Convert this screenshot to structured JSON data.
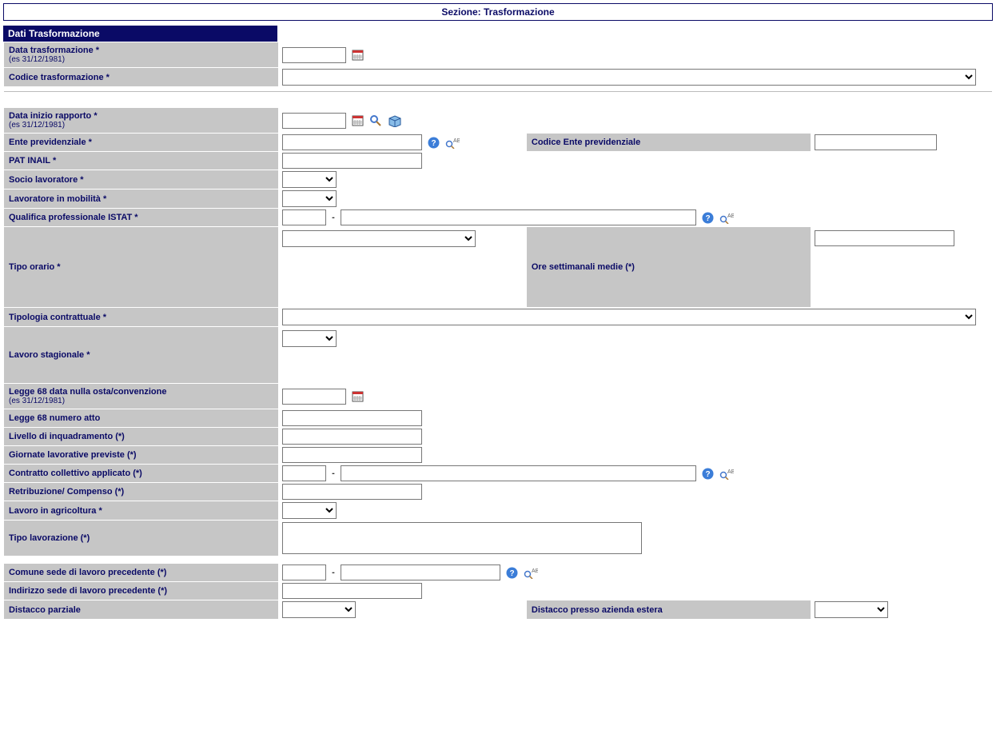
{
  "section_title": "Sezione: Trasformazione",
  "header": "Dati Trasformazione",
  "hint_date": "(es 31/12/1981)",
  "rows": {
    "data_trasf": "Data trasformazione *",
    "codice_trasf": "Codice trasformazione *",
    "data_inizio": "Data inizio rapporto *",
    "ente_prev": "Ente previdenziale *",
    "codice_ente": "Codice Ente previdenziale",
    "pat_inail": "PAT INAIL *",
    "socio": "Socio lavoratore *",
    "mobilita": "Lavoratore in mobilità *",
    "qualifica": "Qualifica professionale ISTAT *",
    "tipo_orario": "Tipo orario *",
    "ore_sett": "Ore settimanali medie (*)",
    "tipologia": "Tipologia contrattuale *",
    "lavoro_stag": "Lavoro stagionale *",
    "legge68_data": "Legge 68 data nulla osta/convenzione",
    "legge68_num": "Legge 68 numero atto",
    "livello": "Livello di inquadramento (*)",
    "giornate": "Giornate lavorative previste (*)",
    "contratto_coll": "Contratto collettivo applicato (*)",
    "retribuzione": "Retribuzione/ Compenso (*)",
    "lavoro_agr": "Lavoro in agricoltura *",
    "tipo_lavorazione": "Tipo lavorazione (*)",
    "comune_sede": "Comune sede di lavoro precedente (*)",
    "indirizzo_sede": "Indirizzo sede di lavoro precedente (*)",
    "distacco_parz": "Distacco parziale",
    "distacco_estera": "Distacco presso azienda estera"
  }
}
